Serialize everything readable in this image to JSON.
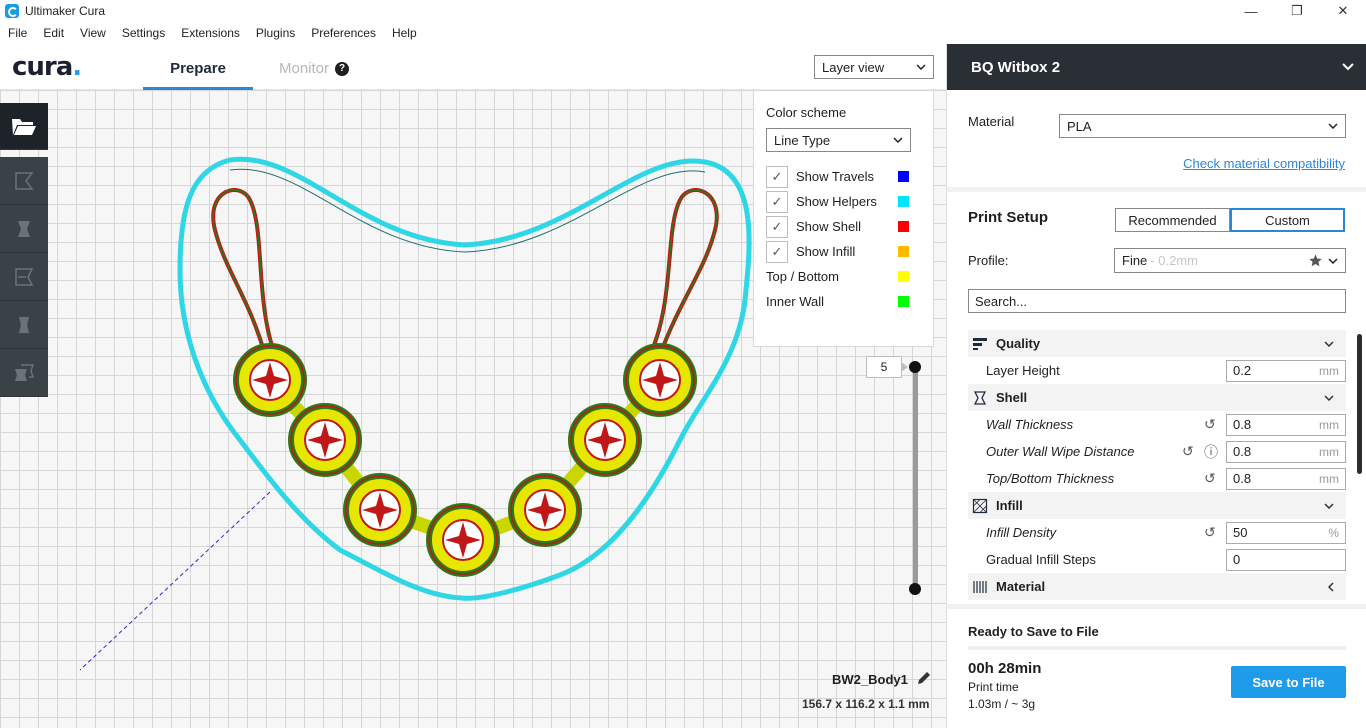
{
  "window": {
    "title": "Ultimaker Cura",
    "minimize": "—",
    "maximize": "❐",
    "close": "✕"
  },
  "menu": [
    "File",
    "Edit",
    "View",
    "Settings",
    "Extensions",
    "Plugins",
    "Preferences",
    "Help"
  ],
  "header": {
    "logo": "cura",
    "logo_dot": ".",
    "tab_prepare": "Prepare",
    "tab_monitor": "Monitor",
    "view_mode": "Layer view"
  },
  "layer_panel": {
    "color_scheme_label": "Color scheme",
    "color_scheme_value": "Line Type",
    "items": [
      {
        "label": "Show Travels",
        "checked": true,
        "color": "#0000ff"
      },
      {
        "label": "Show Helpers",
        "checked": true,
        "color": "#00e5ff"
      },
      {
        "label": "Show Shell",
        "checked": true,
        "color": "#ff0000"
      },
      {
        "label": "Show Infill",
        "checked": true,
        "color": "#ffbb00"
      },
      {
        "label": "Top / Bottom",
        "checked": false,
        "color": "#ffff00"
      },
      {
        "label": "Inner Wall",
        "checked": false,
        "color": "#00ff00"
      }
    ]
  },
  "layer_slider": {
    "current_layer": "5"
  },
  "object": {
    "name": "BW2_Body1",
    "dimensions": "156.7 x 116.2 x 1.1 mm"
  },
  "sidebar": {
    "machine": "BQ Witbox 2",
    "material_label": "Material",
    "material_value": "PLA",
    "compat_link": "Check material compatibility",
    "print_setup": "Print Setup",
    "mode_recommended": "Recommended",
    "mode_custom": "Custom",
    "profile_label": "Profile:",
    "profile_value": "Fine",
    "profile_sub": "- 0.2mm",
    "search_placeholder": "Search...",
    "settings": {
      "quality": "Quality",
      "layer_height": {
        "label": "Layer Height",
        "value": "0.2",
        "unit": "mm"
      },
      "shell": "Shell",
      "wall_thickness": {
        "label": "Wall Thickness",
        "value": "0.8",
        "unit": "mm"
      },
      "outer_wipe": {
        "label": "Outer Wall Wipe Distance",
        "value": "0.8",
        "unit": "mm"
      },
      "topbottom": {
        "label": "Top/Bottom Thickness",
        "value": "0.8",
        "unit": "mm"
      },
      "infill": "Infill",
      "infill_density": {
        "label": "Infill Density",
        "value": "50",
        "unit": "%"
      },
      "gradual": {
        "label": "Gradual Infill Steps",
        "value": "0"
      },
      "material": "Material"
    },
    "ready": "Ready to Save to File",
    "print_time": "00h 28min",
    "print_time_label": "Print time",
    "usage": "1.03m / ~ 3g",
    "save_button": "Save to File"
  }
}
